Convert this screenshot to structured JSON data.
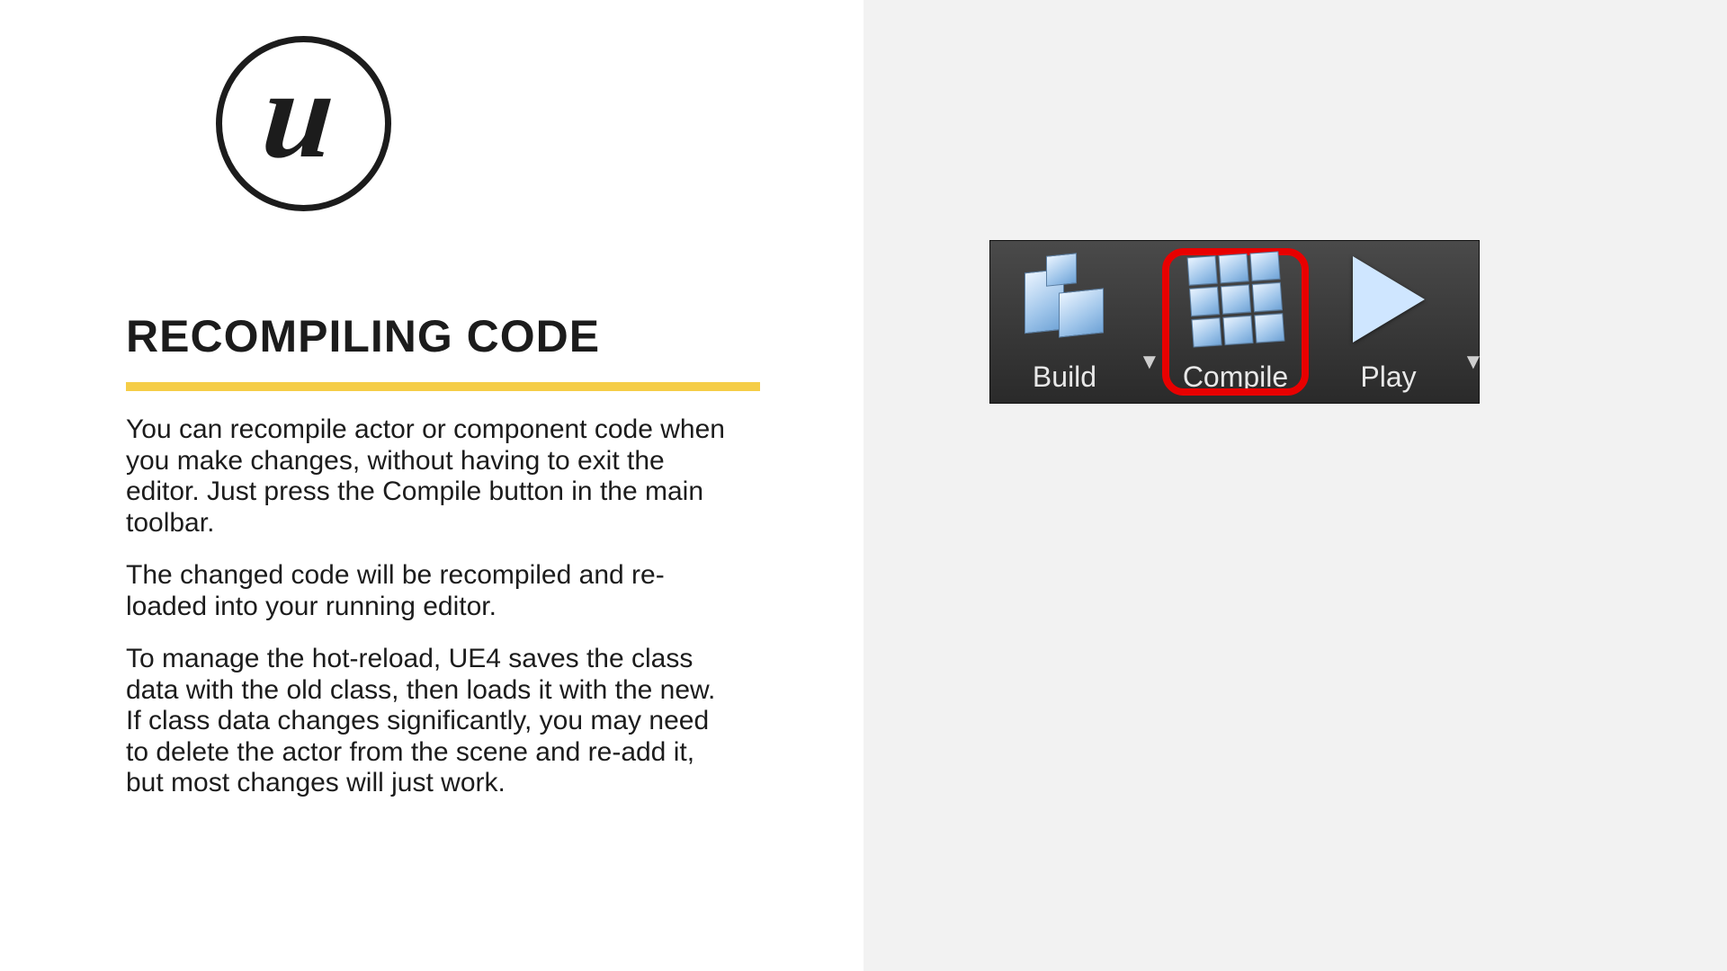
{
  "slide": {
    "heading": "RECOMPILING CODE",
    "para1": "You can recompile actor or component code when you make changes, without having to exit the editor. Just press the Compile button in the main toolbar.",
    "para2": "The changed code will be recompiled and re-loaded into your running editor.",
    "para3": "To manage the hot-reload, UE4 saves the class data with the old class, then loads it with the new. If class data changes significantly, you may need to delete the actor from the scene and re-add it, but most changes will just work."
  },
  "toolbar": {
    "build": "Build",
    "compile": "Compile",
    "play": "Play"
  },
  "logo": {
    "letter": "u"
  }
}
